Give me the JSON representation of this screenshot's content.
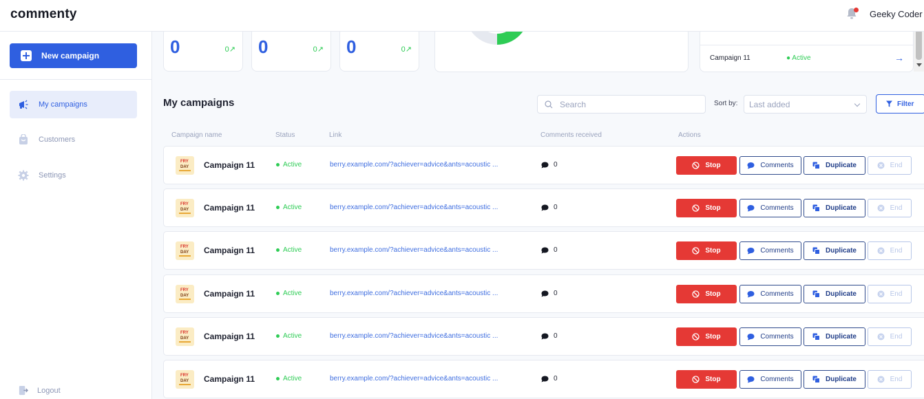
{
  "app": {
    "logo": "commenty",
    "username": "Geeky Coder"
  },
  "sidebar": {
    "new_campaign_label": "New campaign",
    "items": [
      {
        "label": "My campaigns",
        "active": true,
        "icon": "megaphone-icon"
      },
      {
        "label": "Customers",
        "active": false,
        "icon": "bag-icon"
      },
      {
        "label": "Settings",
        "active": false,
        "icon": "gear-icon"
      }
    ],
    "logout_label": "Logout"
  },
  "stats": [
    {
      "value": "0",
      "trend": "0"
    },
    {
      "value": "0",
      "trend": "0"
    },
    {
      "value": "0",
      "trend": "0"
    }
  ],
  "mini_list": {
    "name": "Campaign 11",
    "status": "Active"
  },
  "campaigns_section": {
    "title": "My campaigns",
    "search_placeholder": "Search",
    "sort_label": "Sort by:",
    "sort_value": "Last added",
    "filter_label": "Filter"
  },
  "columns": {
    "name": "Campaign name",
    "status": "Status",
    "link": "Link",
    "comments": "Comments received",
    "actions": "Actions"
  },
  "rows": [
    {
      "name": "Campaign 11",
      "status": "Active",
      "link": "berry.example.com/?achiever=advice&ants=acoustic ...",
      "comments": "0"
    },
    {
      "name": "Campaign 11",
      "status": "Active",
      "link": "berry.example.com/?achiever=advice&ants=acoustic ...",
      "comments": "0"
    },
    {
      "name": "Campaign 11",
      "status": "Active",
      "link": "berry.example.com/?achiever=advice&ants=acoustic ...",
      "comments": "0"
    },
    {
      "name": "Campaign 11",
      "status": "Active",
      "link": "berry.example.com/?achiever=advice&ants=acoustic ...",
      "comments": "0"
    },
    {
      "name": "Campaign 11",
      "status": "Active",
      "link": "berry.example.com/?achiever=advice&ants=acoustic ...",
      "comments": "0"
    },
    {
      "name": "Campaign 11",
      "status": "Active",
      "link": "berry.example.com/?achiever=advice&ants=acoustic ...",
      "comments": "0"
    }
  ],
  "row_actions": {
    "stop": "Stop",
    "comments": "Comments",
    "duplicate": "Duplicate",
    "end": "End"
  },
  "thumbnail_text": {
    "line1": "FRY",
    "line2": "DAY"
  },
  "colors": {
    "primary": "#2f5fe0",
    "danger": "#e53935",
    "success": "#2ecc55",
    "muted": "#9aa3bd"
  }
}
